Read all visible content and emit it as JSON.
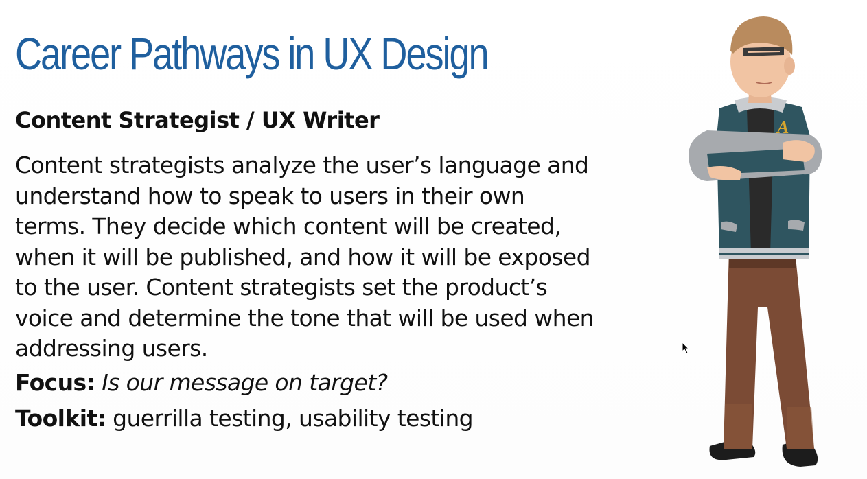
{
  "slide": {
    "title": "Career Pathways in UX Design",
    "subtitle": "Content Strategist / UX Writer",
    "body_lines": [
      "Content strategists analyze the user’s language and",
      "understand how to speak to users in their own",
      "terms. They decide which content will be created,",
      "when it will be published, and how it will be exposed",
      "to the user. Content strategists set the product’s",
      "voice and determine the tone that will be used when",
      "addressing users."
    ],
    "focus_label": "Focus:",
    "focus_text": "Is our message on target?",
    "toolkit_label": "Toolkit:",
    "toolkit_text": "guerrilla testing, usability testing"
  },
  "character": {
    "jacket_letter": "A"
  },
  "colors": {
    "title": "#1f5f9e",
    "text": "#111111",
    "jacket": "#2f5560",
    "sleeves": "#a7aaae",
    "pants": "#7b4b35",
    "hair": "#b98b5e",
    "skin": "#f1c4a3"
  }
}
